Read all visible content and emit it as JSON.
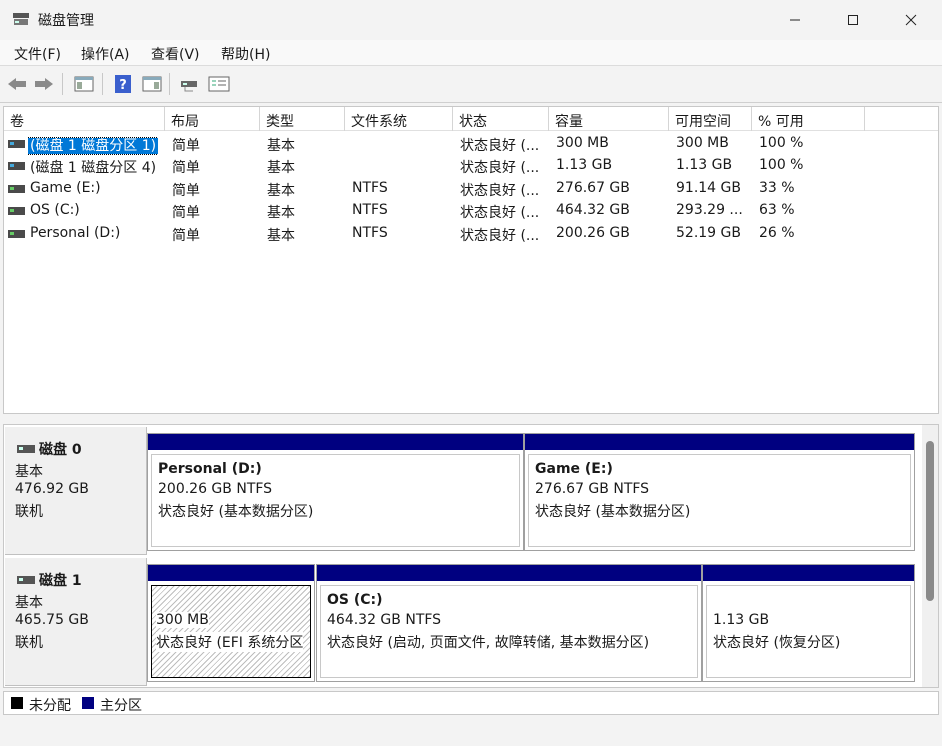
{
  "window": {
    "title": "磁盘管理"
  },
  "menu": [
    {
      "label": "文件(F)"
    },
    {
      "label": "操作(A)"
    },
    {
      "label": "查看(V)"
    },
    {
      "label": "帮助(H)"
    }
  ],
  "toolbar": {
    "icons": [
      "back-arrow-icon",
      "forward-arrow-icon",
      "console-tree-icon",
      "help-icon",
      "action-pane-icon",
      "connect-disk-icon",
      "properties-icon"
    ]
  },
  "volume_table": {
    "columns": [
      "卷",
      "布局",
      "类型",
      "文件系统",
      "状态",
      "容量",
      "可用空间",
      "% 可用"
    ],
    "rows": [
      {
        "volume": "(磁盘 1 磁盘分区 1)",
        "layout": "简单",
        "type": "基本",
        "fs": "",
        "status": "状态良好 (...",
        "capacity": "300 MB",
        "free": "300 MB",
        "pct": "100 %",
        "selected": true
      },
      {
        "volume": "(磁盘 1 磁盘分区 4)",
        "layout": "简单",
        "type": "基本",
        "fs": "",
        "status": "状态良好 (...",
        "capacity": "1.13 GB",
        "free": "1.13 GB",
        "pct": "100 %",
        "selected": false
      },
      {
        "volume": "Game (E:)",
        "layout": "简单",
        "type": "基本",
        "fs": "NTFS",
        "status": "状态良好 (...",
        "capacity": "276.67 GB",
        "free": "91.14 GB",
        "pct": "33 %",
        "selected": false
      },
      {
        "volume": "OS (C:)",
        "layout": "简单",
        "type": "基本",
        "fs": "NTFS",
        "status": "状态良好 (...",
        "capacity": "464.32 GB",
        "free": "293.29 ...",
        "pct": "63 %",
        "selected": false
      },
      {
        "volume": "Personal (D:)",
        "layout": "简单",
        "type": "基本",
        "fs": "NTFS",
        "status": "状态良好 (...",
        "capacity": "200.26 GB",
        "free": "52.19 GB",
        "pct": "26 %",
        "selected": false
      }
    ]
  },
  "disks": [
    {
      "name": "磁盘 0",
      "type": "基本",
      "size": "476.92 GB",
      "state": "联机",
      "partitions": [
        {
          "name": "Personal  (D:)",
          "size_fs": "200.26 GB NTFS",
          "status": "状态良好 (基本数据分区)"
        },
        {
          "name": "Game  (E:)",
          "size_fs": "276.67 GB NTFS",
          "status": "状态良好 (基本数据分区)"
        }
      ]
    },
    {
      "name": "磁盘 1",
      "type": "基本",
      "size": "465.75 GB",
      "state": "联机",
      "partitions": [
        {
          "name": "",
          "size_fs": "300 MB",
          "status": "状态良好 (EFI 系统分区"
        },
        {
          "name": "OS  (C:)",
          "size_fs": "464.32 GB NTFS",
          "status": "状态良好 (启动, 页面文件, 故障转储, 基本数据分区)"
        },
        {
          "name": "",
          "size_fs": "1.13 GB",
          "status": "状态良好 (恢复分区)"
        }
      ]
    }
  ],
  "legend": [
    {
      "label": "未分配",
      "color": "#000000"
    },
    {
      "label": "主分区",
      "color": "#000080"
    }
  ],
  "colors": {
    "partition_header": "#000080",
    "selection": "#0078d7"
  }
}
